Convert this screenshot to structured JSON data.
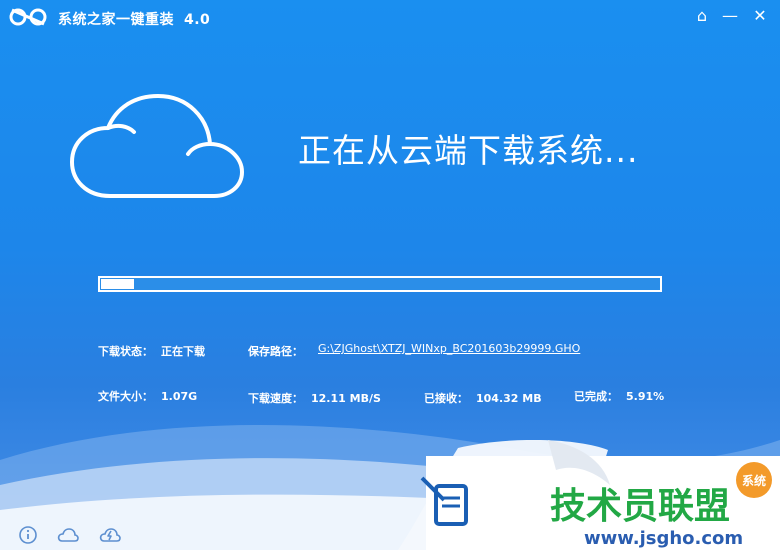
{
  "window": {
    "title": "系统之家一键重装",
    "version": "4.0"
  },
  "titlebar_buttons": {
    "home": "⌂",
    "minimize": "—",
    "close": "✕"
  },
  "main": {
    "headline": "正在从云端下载系统..."
  },
  "progress": {
    "fraction": 0.0591
  },
  "info": {
    "download_status_label": "下载状态：",
    "download_status_value": "正在下载",
    "save_path_label": "保存路径：",
    "save_path_value": "G:\\ZJGhost\\XTZJ_WINxp_BC201603b29999.GHO",
    "file_size_label": "文件大小：",
    "file_size_value": "1.07G",
    "speed_label": "下载速度：",
    "speed_value": "12.11 MB/S",
    "received_label": "已接收：",
    "received_value": "104.32 MB",
    "completed_label": "已完成：",
    "completed_value": "5.91%"
  },
  "watermark": {
    "brand": "技术员联盟",
    "url": "www.jsgho.com",
    "badge": "系统"
  },
  "colors": {
    "background": "#1d86ea",
    "progress_fill": "#ffffff",
    "watermark_green": "#22a845"
  },
  "icons": {
    "app_logo": "app-logo-icon",
    "cloud": "cloud-icon",
    "info": "info-icon",
    "cloud_small": "cloud-small-icon",
    "speed": "lightning-icon"
  }
}
